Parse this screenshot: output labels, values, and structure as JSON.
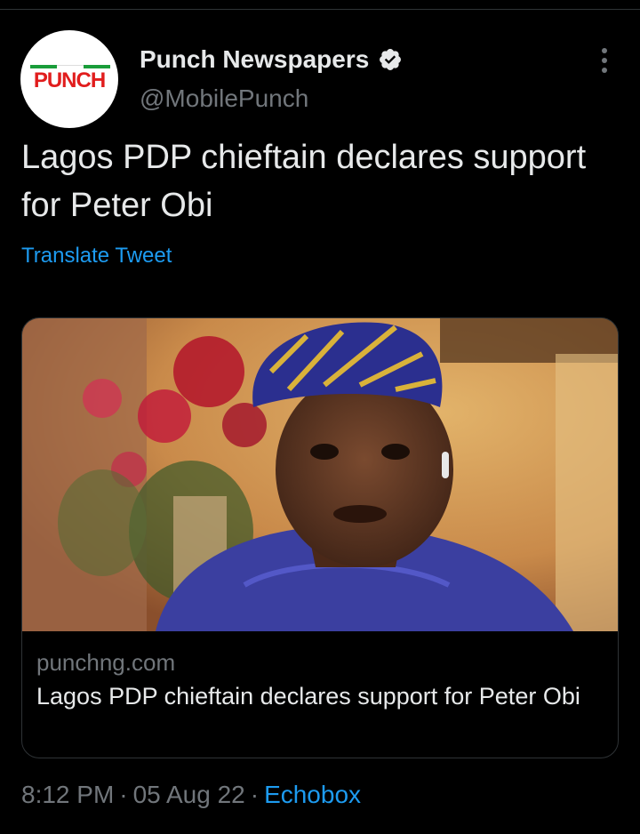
{
  "tweet": {
    "author": {
      "display_name": "Punch Newspapers",
      "handle": "@MobilePunch",
      "verified": true,
      "avatar_logo_text": "PUNCH"
    },
    "text": "Lagos PDP chieftain declares support for Peter Obi",
    "translate_label": "Translate Tweet",
    "menu_icon": "more-vertical-icon"
  },
  "card": {
    "image_description_icon": "article-photo",
    "domain": "punchng.com",
    "title": "Lagos PDP chieftain declares support for Peter Obi"
  },
  "meta": {
    "time": "8:12 PM",
    "separator": "·",
    "date": "05 Aug 22",
    "source": "Echobox"
  },
  "colors": {
    "background": "#000000",
    "text_primary": "#e7e9ea",
    "text_secondary": "#71767b",
    "accent": "#1d9bf0",
    "border": "#2f3336",
    "logo_red": "#e11d1d",
    "logo_green": "#1a9d3a"
  }
}
